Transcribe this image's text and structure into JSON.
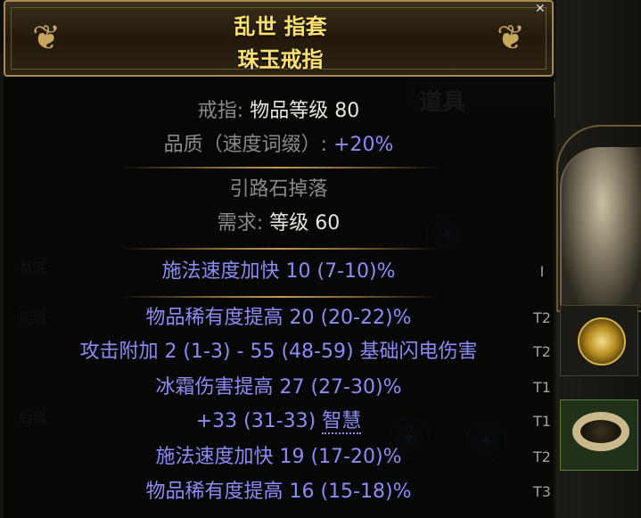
{
  "item": {
    "name": "乱世 指套",
    "base": "珠玉戒指"
  },
  "properties": {
    "type_label": "戒指:",
    "item_level_label": "物品等级",
    "item_level": "80",
    "quality_label": "品质（速度词缀）:",
    "quality_value": "+20%",
    "source": "引路石掉落",
    "requires_label": "需求:",
    "requires_level_label": "等级",
    "requires_level": "60"
  },
  "implicit": {
    "text": "施法速度加快 10 (7-10)%",
    "tier": "I"
  },
  "prefixes": [
    {
      "text": "物品稀有度提高 20 (20-22)%",
      "tier": "T2"
    },
    {
      "text": "攻击附加 2 (1-3) - 55 (48-59) 基础闪电伤害",
      "tier": "T2"
    },
    {
      "text": "冰霜伤害提高 27 (27-30)%",
      "tier": "T1"
    }
  ],
  "suffixes": [
    {
      "text_pre": "+33 (31-33) ",
      "text_keyword": "智慧",
      "tier": "T1"
    },
    {
      "text": "施法速度加快 19 (17-20)%",
      "tier": "T2"
    },
    {
      "text": "物品稀有度提高 16 (15-18)%",
      "tier": "T3"
    }
  ],
  "background": {
    "tab_label": "道具",
    "side_labels": [
      "基底",
      "前缀",
      "后缀"
    ]
  },
  "colors": {
    "title": "#fbe072",
    "magic_blue": "#8d8cf5",
    "white": "#e8e6e0",
    "gray": "#8c8a86"
  },
  "icons": {
    "close": "close-icon",
    "ornament": "filigree-ornament-icon",
    "orb": "socket-orb-icon"
  }
}
